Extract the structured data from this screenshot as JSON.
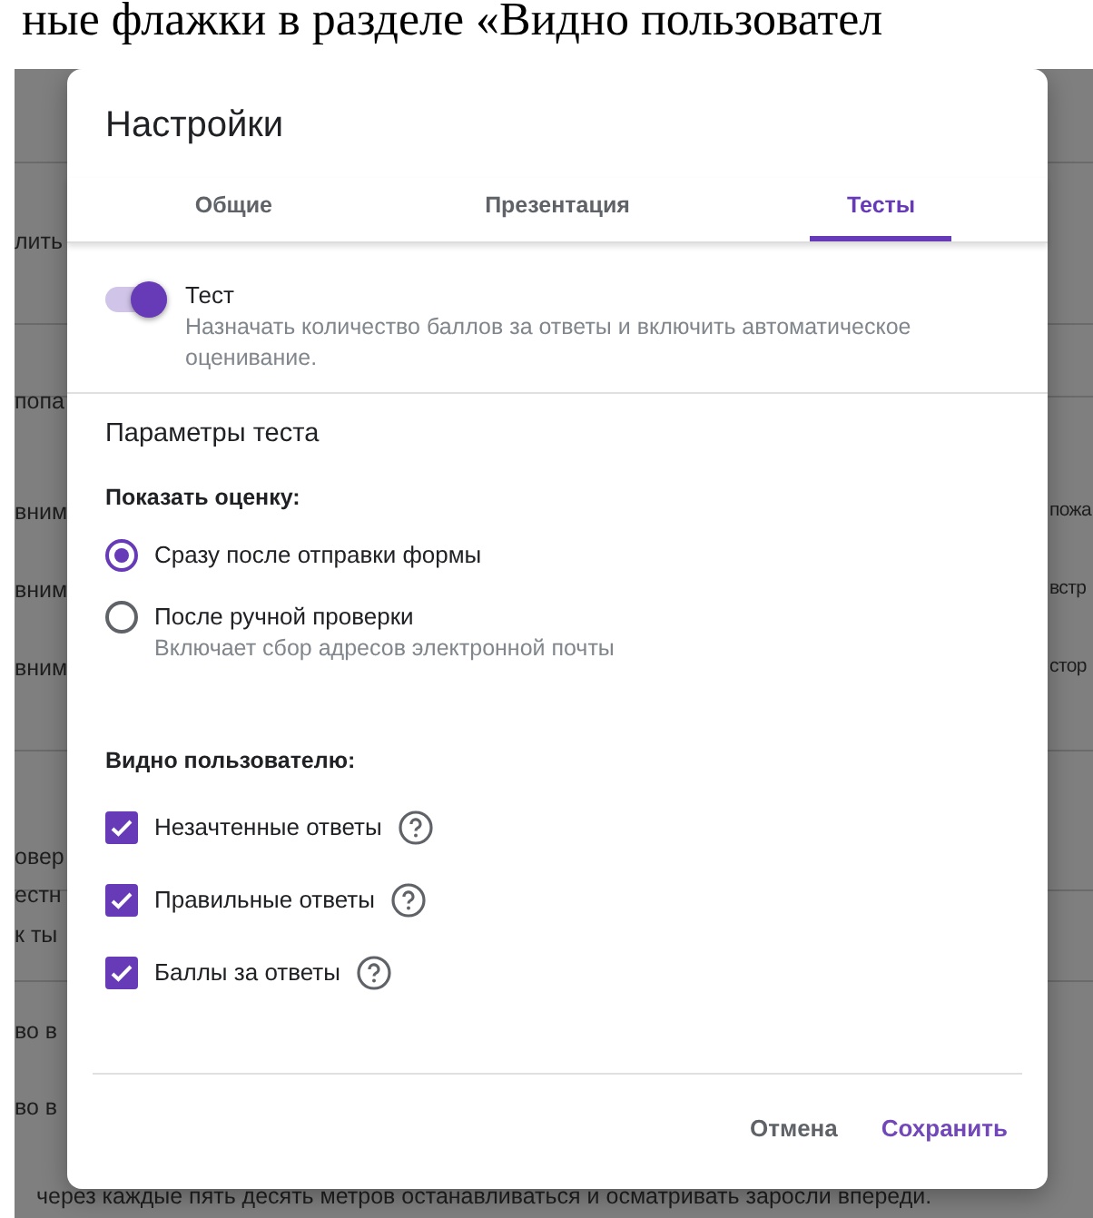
{
  "document_text": "ные флажки в разделе «Видно пользовател",
  "background": {
    "left_fragments": [
      "лить",
      "попа",
      "вним",
      "вним",
      "вним",
      "овер",
      "естн",
      "к ты",
      "во в",
      "во в"
    ],
    "right_fragments": [
      "пожа",
      "встр",
      "стор"
    ],
    "bottom_line": "через каждые пять десять метров останавливаться и осматривать заросли впереди."
  },
  "dialog": {
    "title": "Настройки",
    "tabs": [
      {
        "label": "Общие",
        "selected": false
      },
      {
        "label": "Презентация",
        "selected": false
      },
      {
        "label": "Тесты",
        "selected": true
      }
    ],
    "quiz_toggle": {
      "label": "Тест",
      "description": "Назначать количество баллов за ответы и включить автоматическое оценивание.",
      "on": true
    },
    "section_title": "Параметры теста",
    "release_grade": {
      "label": "Показать оценку:",
      "options": [
        {
          "label": "Сразу после отправки формы",
          "selected": true
        },
        {
          "label": "После ручной проверки",
          "description": "Включает сбор адресов электронной почты",
          "selected": false
        }
      ]
    },
    "respondent_can_see": {
      "label": "Видно пользователю:",
      "items": [
        {
          "label": "Незачтенные ответы",
          "checked": true
        },
        {
          "label": "Правильные ответы",
          "checked": true
        },
        {
          "label": "Баллы за ответы",
          "checked": true
        }
      ]
    },
    "buttons": [
      {
        "label": "Отмена",
        "kind": "secondary"
      },
      {
        "label": "Сохранить",
        "kind": "primary"
      }
    ]
  }
}
